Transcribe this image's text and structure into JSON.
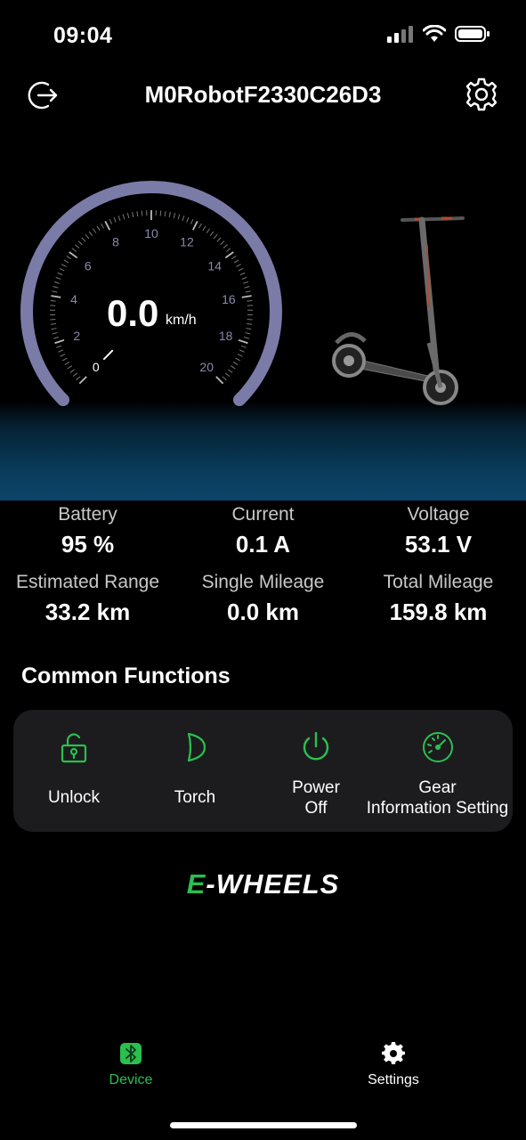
{
  "status_bar": {
    "time": "09:04"
  },
  "header": {
    "title": "M0RobotF2330C26D3"
  },
  "speedometer": {
    "value": "0.0",
    "unit": "km/h",
    "ticks": [
      "0",
      "2",
      "4",
      "6",
      "8",
      "10",
      "12",
      "14",
      "16",
      "18",
      "20"
    ]
  },
  "stats": [
    {
      "label": "Battery",
      "value": "95 %"
    },
    {
      "label": "Current",
      "value": "0.1 A"
    },
    {
      "label": "Voltage",
      "value": "53.1 V"
    },
    {
      "label": "Estimated Range",
      "value": "33.2 km"
    },
    {
      "label": "Single Mileage",
      "value": "0.0 km"
    },
    {
      "label": "Total Mileage",
      "value": "159.8 km"
    }
  ],
  "common_functions": {
    "title": "Common Functions",
    "items": [
      {
        "label_line1": "Unlock",
        "label_line2": "",
        "icon": "lock-icon"
      },
      {
        "label_line1": "Torch",
        "label_line2": "",
        "icon": "torch-icon"
      },
      {
        "label_line1": "Power",
        "label_line2": "Off",
        "icon": "power-icon"
      },
      {
        "label_line1": "Gear",
        "label_line2": "Information Setting",
        "icon": "gauge-icon"
      }
    ]
  },
  "brand": {
    "prefix": "E",
    "rest": "-WHEELS"
  },
  "bottom_nav": {
    "items": [
      {
        "label": "Device",
        "icon": "bluetooth-icon",
        "active": true
      },
      {
        "label": "Settings",
        "icon": "gear-icon",
        "active": false
      }
    ]
  },
  "colors": {
    "accent": "#2bbf4f",
    "gauge_arc": "#7b7ba8",
    "card": "#1c1c1e"
  }
}
